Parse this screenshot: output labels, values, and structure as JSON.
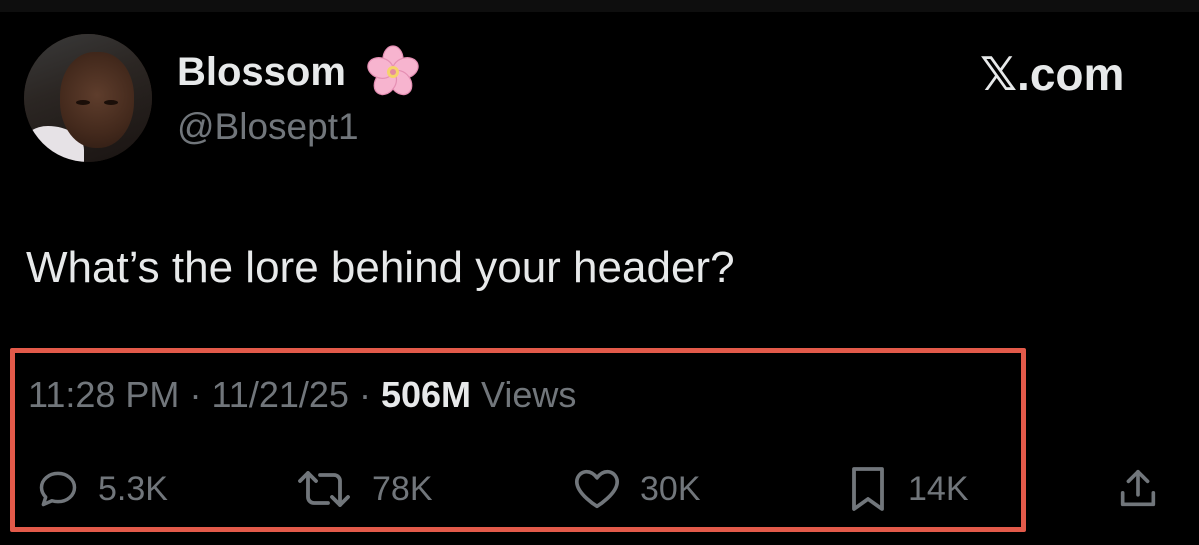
{
  "user": {
    "display_name": "Blossom",
    "name_emoji": "cherry-blossom",
    "handle": "@Blosept1"
  },
  "brand": "𝕏.com",
  "tweet": {
    "text": "What’s the lore behind your header?",
    "time": "11:28 PM",
    "date": "11/21/25",
    "separator": "·",
    "views_count": "506M",
    "views_label": "Views"
  },
  "actions": {
    "reply": {
      "icon": "reply-icon",
      "count": "5.3K"
    },
    "repost": {
      "icon": "repost-icon",
      "count": "78K"
    },
    "like": {
      "icon": "heart-icon",
      "count": "30K"
    },
    "bookmark": {
      "icon": "bookmark-icon",
      "count": "14K"
    },
    "share": {
      "icon": "share-icon"
    }
  },
  "colors": {
    "background": "#000000",
    "primary_text": "#e7e9ea",
    "secondary_text": "#71767b",
    "highlight_border": "#e35a4a"
  }
}
